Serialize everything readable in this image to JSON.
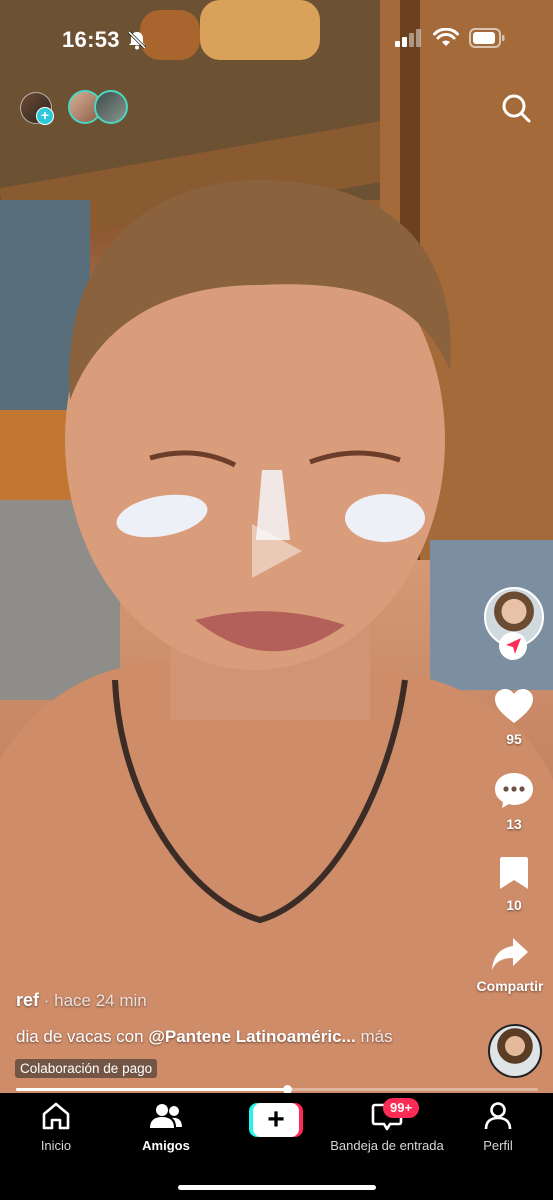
{
  "status_bar": {
    "time": "16:53"
  },
  "icons": {
    "mute": "bell-slash-icon",
    "signal": "cellular-signal-icon",
    "wifi": "wifi-icon",
    "battery": "battery-icon",
    "search": "search-icon",
    "play": "play-icon",
    "like": "heart-icon",
    "comment": "comment-icon",
    "save": "bookmark-icon",
    "share": "share-arrow-icon",
    "follow": "follow-arrow-icon",
    "home": "home-icon",
    "friends": "friends-icon",
    "create": "plus-icon",
    "inbox": "inbox-icon",
    "profile": "profile-icon"
  },
  "top": {
    "add_story_symbol": "+"
  },
  "rail": {
    "likes": "95",
    "comments": "13",
    "saves": "10",
    "share_label": "Compartir"
  },
  "caption": {
    "author": "ref",
    "separator": " · ",
    "time": "hace 24 min",
    "text": "dia de vacas con ",
    "mention": "@Pantene Latinoaméric...",
    "more": " más",
    "paid_label": "Colaboración de pago"
  },
  "progress": {
    "fraction": 0.52
  },
  "nav": {
    "home": "Inicio",
    "friends": "Amigos",
    "create": "+",
    "inbox": "Bandeja de entrada",
    "inbox_badge": "99+",
    "profile": "Perfil"
  },
  "colors": {
    "accent_red": "#fe2c55",
    "accent_cyan": "#25f4ee",
    "story_ring": "#4bd6c0",
    "nav_background": "#000000"
  }
}
